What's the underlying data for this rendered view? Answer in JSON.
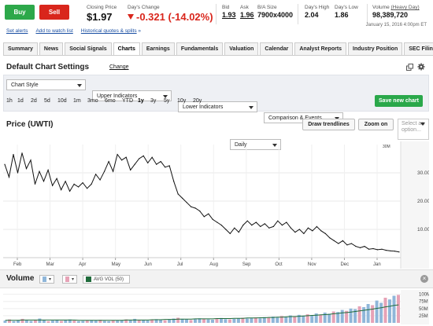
{
  "quote": {
    "buy_label": "Buy",
    "sell_label": "Sell",
    "closing_price_label": "Closing Price",
    "closing_price": "$1.97",
    "days_change_label": "Day's Change",
    "days_change": "-0.321 (-14.02%)",
    "bid_label": "Bid",
    "bid": "1.93",
    "ask_label": "Ask",
    "ask": "1.96",
    "ba_size_label": "B/A Size",
    "ba_size": "7900x4000",
    "days_high_label": "Day's High",
    "days_high": "2.04",
    "days_low_label": "Day's Low",
    "days_low": "1.86",
    "volume_label": "Volume",
    "volume_note": "(Heavy Day)",
    "volume": "98,389,720",
    "timestamp": "January 15, 2016 4:00pm ET"
  },
  "links": {
    "set_alerts": "Set alerts",
    "add_watchlist": "Add to watch list",
    "historical": "Historical quotes & splits",
    "historical_suffix": "»"
  },
  "tabs": [
    "Summary",
    "News",
    "Social Signals",
    "Charts",
    "Earnings",
    "Fundamentals",
    "Valuation",
    "Calendar",
    "Analyst Reports",
    "Industry Position",
    "SEC Filings"
  ],
  "active_tab": "Charts",
  "settings": {
    "title": "Default Chart Settings",
    "change_label": "Change",
    "dropdowns": [
      "Chart Style",
      "Upper Indicators",
      "Lower Indicators",
      "Comparison & Events"
    ],
    "ranges": [
      "1h",
      "1d",
      "2d",
      "5d",
      "10d",
      "1m",
      "3mo",
      "6mo",
      "YTD",
      "1y",
      "3y",
      "5y",
      "10y",
      "20y"
    ],
    "selected_range": "1y",
    "interval": "Daily",
    "save_label": "Save new chart"
  },
  "price_panel": {
    "title": "Price (UWTI)",
    "draw_label": "Draw trendlines",
    "zoom_label": "Zoom on",
    "select_label": "Select an option..."
  },
  "volume_panel": {
    "title": "Volume",
    "avg_label": "AVG VOL (50)",
    "close_glyph": "×"
  },
  "colors": {
    "buy": "#2da84a",
    "sell": "#d9261c",
    "change_negative": "#d9261c",
    "link": "#1a4fa3",
    "price_line": "#111111",
    "volume_up": "#8fb6d9",
    "volume_down": "#e6a2b6",
    "avg_volume": "#1f6b3b"
  },
  "icons": {
    "popout": "popout-icon",
    "settings": "gear-icon",
    "close": "close-icon"
  },
  "chart_data": {
    "type": "line",
    "title": "Price (UWTI)",
    "x_ticks": [
      "Feb",
      "Mar",
      "Apr",
      "May",
      "Jun",
      "Jul",
      "Aug",
      "Sep",
      "Oct",
      "Nov",
      "Dec",
      "Jan"
    ],
    "y_ticks": [
      "10.00",
      "20.00",
      "30.00"
    ],
    "y_corner_label": "30M",
    "ylim": [
      0,
      40
    ],
    "grid": true,
    "series": [
      {
        "values": [
          33.0,
          28.5,
          36.5,
          30.0,
          37.0,
          31.5,
          34.5,
          26.0,
          30.5,
          27.0,
          31.0,
          25.5,
          28.0,
          24.0,
          27.0,
          23.5,
          26.0,
          25.0,
          26.5,
          24.5,
          26.0,
          29.5,
          27.5,
          30.5,
          34.0,
          30.5,
          36.5,
          34.5,
          35.5,
          31.0,
          33.0,
          35.0,
          36.0,
          33.5,
          35.5,
          33.0,
          34.0,
          32.0,
          32.5,
          27.0,
          22.5,
          21.0,
          19.5,
          18.0,
          17.5,
          16.5,
          14.5,
          15.5,
          13.5,
          12.5,
          11.5,
          10.0,
          8.5,
          10.5,
          9.0,
          11.5,
          13.0,
          11.5,
          12.5,
          11.0,
          12.0,
          10.5,
          11.0,
          13.0,
          11.5,
          12.5,
          10.5,
          9.0,
          10.0,
          8.5,
          10.5,
          9.5,
          11.0,
          9.5,
          8.5,
          7.0,
          6.0,
          5.0,
          6.0,
          4.5,
          5.0,
          4.0,
          3.5,
          4.0,
          3.0,
          3.2,
          2.8,
          3.0,
          2.6,
          2.4,
          2.3,
          2.0
        ]
      }
    ]
  },
  "volume_data": {
    "y_ticks": [
      "100M",
      "75M",
      "50M",
      "25M"
    ],
    "ylim": [
      0,
      110
    ],
    "bars": [
      8,
      12,
      6,
      10,
      14,
      9,
      7,
      11,
      15,
      9,
      6,
      8,
      10,
      7,
      9,
      12,
      8,
      6,
      7,
      9,
      10,
      8,
      11,
      7,
      6,
      9,
      8,
      10,
      12,
      9,
      14,
      11,
      9,
      8,
      10,
      13,
      11,
      9,
      12,
      15,
      18,
      14,
      12,
      10,
      13,
      16,
      14,
      12,
      11,
      15,
      17,
      13,
      12,
      14,
      16,
      18,
      15,
      17,
      19,
      16,
      20,
      18,
      22,
      19,
      24,
      21,
      26,
      23,
      28,
      25,
      30,
      27,
      33,
      29,
      36,
      32,
      40,
      38,
      45,
      42,
      50,
      48,
      58,
      55,
      66,
      62,
      78,
      70,
      88,
      82,
      95,
      98
    ],
    "avg": [
      9,
      9,
      9,
      9,
      10,
      10,
      10,
      10,
      10,
      10,
      10,
      10,
      10,
      10,
      10,
      10,
      10,
      9,
      9,
      9,
      9,
      9,
      9,
      9,
      9,
      9,
      9,
      9,
      10,
      10,
      10,
      10,
      10,
      10,
      11,
      11,
      11,
      12,
      12,
      12,
      13,
      13,
      13,
      13,
      14,
      14,
      14,
      14,
      14,
      15,
      15,
      15,
      15,
      16,
      16,
      16,
      17,
      17,
      17,
      18,
      18,
      19,
      19,
      20,
      20,
      21,
      22,
      22,
      23,
      24,
      25,
      26,
      27,
      28,
      29,
      30,
      32,
      33,
      35,
      36,
      38,
      40,
      42,
      44,
      46,
      48,
      51,
      53,
      56,
      58,
      61,
      63
    ]
  }
}
